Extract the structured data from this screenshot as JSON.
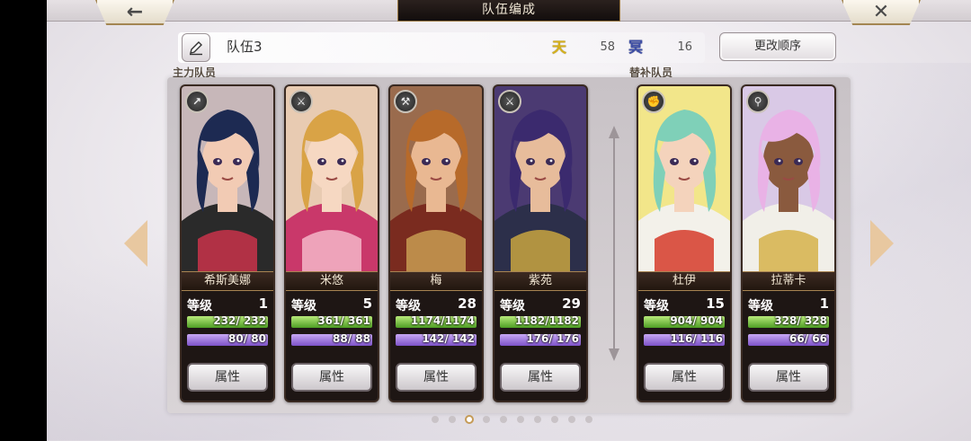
{
  "header": {
    "title": "队伍编成",
    "back_icon": "←",
    "close_icon": "✕"
  },
  "team": {
    "name": "队伍3",
    "heaven_icon": "天",
    "heaven_value": "58",
    "hell_icon": "冥",
    "hell_value": "16",
    "order_button": "更改顺序"
  },
  "sections": {
    "main": "主力队员",
    "sub": "替补队员"
  },
  "labels": {
    "level": "等级",
    "attribute": "属性"
  },
  "members": [
    {
      "name": "希斯美娜",
      "level": "1",
      "hp": "232/ 232",
      "mp": "80/ 80",
      "hp_fill": 1.0,
      "mp_fill": 1.0,
      "class_icon": "spear-icon",
      "badge": "↗",
      "portrait": {
        "hair": "#1d2a52",
        "skin": "#f2cbb4",
        "outfit": "#2a2a2a",
        "accent": "#c9334a",
        "bg": "#c7b7b9"
      }
    },
    {
      "name": "米悠",
      "level": "5",
      "hp": "361/ 361",
      "mp": "88/ 88",
      "hp_fill": 1.0,
      "mp_fill": 1.0,
      "class_icon": "sword-icon",
      "badge": "⚔",
      "portrait": {
        "hair": "#d9a346",
        "skin": "#f6d8c2",
        "outfit": "#c9386a",
        "accent": "#f4b6c8",
        "bg": "#e8cbb2"
      }
    },
    {
      "name": "梅",
      "level": "28",
      "hp": "1174/1174",
      "mp": "142/ 142",
      "hp_fill": 1.0,
      "mp_fill": 1.0,
      "class_icon": "hammer-icon",
      "badge": "⚒",
      "portrait": {
        "hair": "#b76a2a",
        "skin": "#e9b892",
        "outfit": "#7a2b1f",
        "accent": "#c89c52",
        "bg": "#9a6b4d"
      }
    },
    {
      "name": "紫苑",
      "level": "29",
      "hp": "1182/1182",
      "mp": "176/ 176",
      "hp_fill": 1.0,
      "mp_fill": 1.0,
      "class_icon": "katana-icon",
      "badge": "⚔",
      "portrait": {
        "hair": "#3b2a6e",
        "skin": "#e7bc9b",
        "outfit": "#2c2f4a",
        "accent": "#c9a440",
        "bg": "#4b3a72"
      }
    },
    {
      "name": "杜伊",
      "level": "15",
      "hp": "904/ 904",
      "mp": "116/ 116",
      "hp_fill": 1.0,
      "mp_fill": 1.0,
      "class_icon": "gauntlet-icon",
      "badge": "✊",
      "portrait": {
        "hair": "#7fd0b8",
        "skin": "#f4d3bc",
        "outfit": "#f3f1ea",
        "accent": "#d53b2a",
        "bg": "#f2e68a"
      }
    },
    {
      "name": "拉蒂卡",
      "level": "1",
      "hp": "328/ 328",
      "mp": "66/ 66",
      "hp_fill": 1.0,
      "mp_fill": 1.0,
      "class_icon": "staff-icon",
      "badge": "⚲",
      "portrait": {
        "hair": "#e9b2e6",
        "skin": "#8a5a3e",
        "outfit": "#f1efe8",
        "accent": "#d6b14a",
        "bg": "#d9c9e6"
      }
    }
  ],
  "pagination": {
    "count": 10,
    "active": 2
  }
}
